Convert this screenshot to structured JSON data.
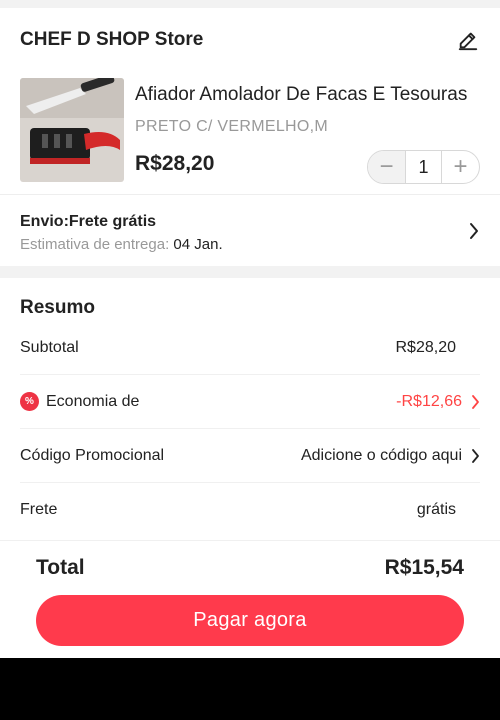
{
  "store": {
    "name": "CHEF D SHOP Store",
    "edit_icon": "pencil-icon"
  },
  "product": {
    "title": "Afiador Amolador De Facas E Tesouras",
    "variant": "PRETO C/ VERMELHO,M",
    "price": "R$28,20",
    "quantity": "1",
    "minus_symbol": "−",
    "plus_symbol": "+"
  },
  "shipping": {
    "label": "Envio:Frete grátis",
    "eta_label": "Estimativa de entrega: ",
    "eta_date": "04 Jan."
  },
  "summary": {
    "title": "Resumo",
    "subtotal_label": "Subtotal",
    "subtotal_value": "R$28,20",
    "discount_icon_text": "%",
    "discount_label": "Economia de",
    "discount_value": "-R$12,66",
    "promo_label": "Código Promocional",
    "promo_value": "Adicione o código aqui",
    "freight_label": "Frete",
    "freight_value": "grátis"
  },
  "footer": {
    "total_label": "Total",
    "total_value": "R$15,54",
    "pay_label": "Pagar agora"
  },
  "colors": {
    "accent": "#ff3a4c",
    "discount": "#ff4444"
  }
}
